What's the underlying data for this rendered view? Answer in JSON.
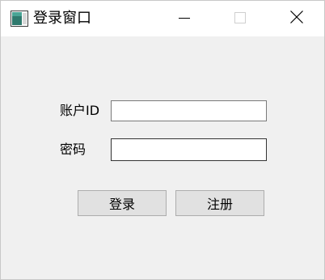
{
  "window": {
    "title": "登录窗口",
    "app_icon": "window-app-icon",
    "controls": {
      "minimize_icon": "minimize-icon",
      "maximize_icon": "maximize-icon",
      "close_icon": "close-icon"
    }
  },
  "form": {
    "account_label": "账户ID",
    "account_value": "",
    "password_label": "密码",
    "password_value": ""
  },
  "buttons": {
    "login_label": "登录",
    "register_label": "注册"
  },
  "colors": {
    "window_bg": "#f0f0f0",
    "titlebar_bg": "#ffffff",
    "button_bg": "#e1e1e1",
    "button_border": "#adadad"
  }
}
